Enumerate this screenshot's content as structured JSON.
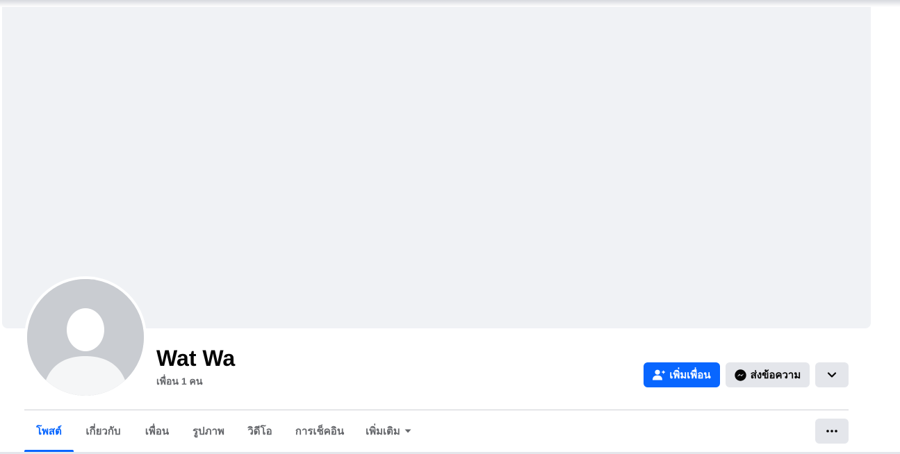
{
  "profile": {
    "name": "Wat Wa",
    "friend_count": "เพื่อน 1 คน"
  },
  "actions": {
    "add_friend_label": "เพิ่มเพื่อน",
    "add_friend_icon": "person-add-icon",
    "message_label": "ส่งข้อความ",
    "message_icon": "messenger-icon",
    "dropdown_icon": "chevron-down-icon"
  },
  "tabs": [
    {
      "label": "โพสต์",
      "active": true
    },
    {
      "label": "เกี่ยวกับ",
      "active": false
    },
    {
      "label": "เพื่อน",
      "active": false
    },
    {
      "label": "รูปภาพ",
      "active": false
    },
    {
      "label": "วิดีโอ",
      "active": false
    },
    {
      "label": "การเช็คอิน",
      "active": false
    },
    {
      "label": "เพิ่มเติม",
      "active": false
    }
  ],
  "colors": {
    "accent": "#0866ff",
    "cover": "#f0f2f5",
    "secondary_button": "#e4e6eb",
    "muted_text": "#65676b"
  }
}
